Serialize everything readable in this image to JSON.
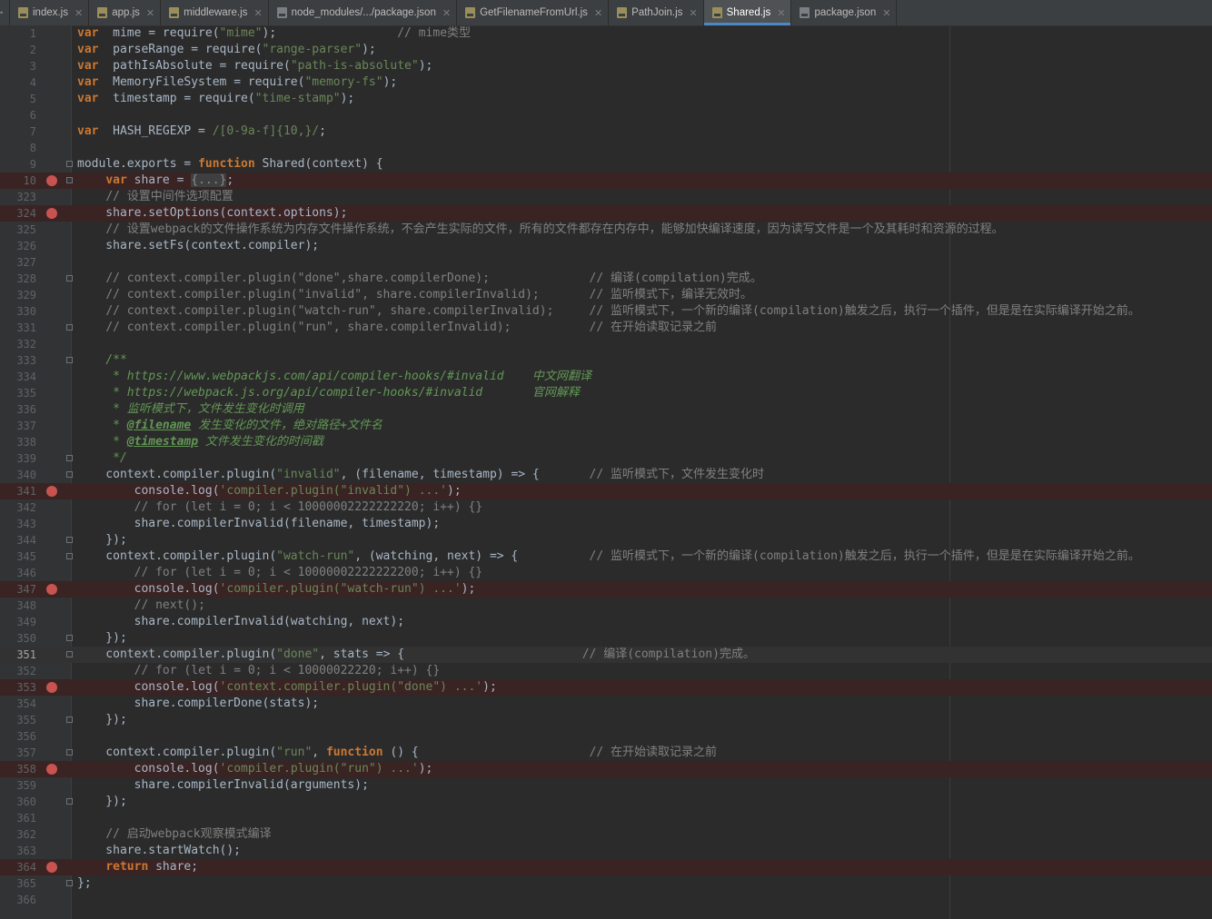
{
  "tabs": [
    {
      "label": "index.js",
      "icon": "js-file-icon",
      "active": false
    },
    {
      "label": "app.js",
      "icon": "js-file-icon",
      "active": false
    },
    {
      "label": "middleware.js",
      "icon": "js-file-icon",
      "active": false
    },
    {
      "label": "node_modules/.../package.json",
      "icon": "json-file-icon",
      "active": false
    },
    {
      "label": "GetFilenameFromUrl.js",
      "icon": "js-file-icon",
      "active": false
    },
    {
      "label": "PathJoin.js",
      "icon": "js-file-icon",
      "active": false
    },
    {
      "label": "Shared.js",
      "icon": "js-file-icon",
      "active": true
    },
    {
      "label": "package.json",
      "icon": "json-file-icon",
      "active": false
    }
  ],
  "editor": {
    "colors": {
      "background": "#2b2b2b",
      "keyword": "#cc7832",
      "string": "#6a8759",
      "comment": "#808080",
      "doc_comment": "#629755",
      "breakpoint": "#c75450",
      "breakpoint_line": "#3a2323",
      "active_tab_underline": "#4a88c7"
    },
    "lines": [
      {
        "num": "1",
        "segs": [
          [
            "kw",
            "var"
          ],
          [
            "",
            "  mime = require("
          ],
          [
            "str",
            "\"mime\""
          ],
          [
            "",
            ");                 "
          ],
          [
            "cm",
            "// mime类型"
          ]
        ]
      },
      {
        "num": "2",
        "segs": [
          [
            "kw",
            "var"
          ],
          [
            "",
            "  parseRange = require("
          ],
          [
            "str",
            "\"range-parser\""
          ],
          [
            "",
            ");"
          ]
        ]
      },
      {
        "num": "3",
        "segs": [
          [
            "kw",
            "var"
          ],
          [
            "",
            "  pathIsAbsolute = require("
          ],
          [
            "str",
            "\"path-is-absolute\""
          ],
          [
            "",
            ");"
          ]
        ]
      },
      {
        "num": "4",
        "segs": [
          [
            "kw",
            "var"
          ],
          [
            "",
            "  MemoryFileSystem = require("
          ],
          [
            "str",
            "\"memory-fs\""
          ],
          [
            "",
            ");"
          ]
        ]
      },
      {
        "num": "5",
        "segs": [
          [
            "kw",
            "var"
          ],
          [
            "",
            "  timestamp = require("
          ],
          [
            "str",
            "\"time-stamp\""
          ],
          [
            "",
            ");"
          ]
        ]
      },
      {
        "num": "6",
        "segs": []
      },
      {
        "num": "7",
        "segs": [
          [
            "kw",
            "var"
          ],
          [
            "",
            "  HASH_REGEXP = "
          ],
          [
            "str",
            "/[0-9a-f]{10,}/"
          ],
          [
            "",
            ";"
          ]
        ]
      },
      {
        "num": "8",
        "segs": []
      },
      {
        "num": "9",
        "fold": true,
        "segs": [
          [
            "",
            "module.exports = "
          ],
          [
            "kw",
            "function"
          ],
          [
            "",
            " Shared(context) {"
          ]
        ]
      },
      {
        "num": "10",
        "bp": true,
        "fold": true,
        "segs": [
          [
            "",
            "    "
          ],
          [
            "kw",
            "var"
          ],
          [
            "",
            " share = "
          ],
          [
            "fold-ph",
            "{...}"
          ],
          [
            "",
            ";"
          ]
        ]
      },
      {
        "num": "323",
        "segs": [
          [
            "",
            "    "
          ],
          [
            "cm",
            "// 设置中间件选项配置"
          ]
        ]
      },
      {
        "num": "324",
        "bp": true,
        "segs": [
          [
            "",
            "    share.setOptions(context.options);"
          ]
        ]
      },
      {
        "num": "325",
        "segs": [
          [
            "",
            "    "
          ],
          [
            "cm",
            "// 设置webpack的文件操作系统为内存文件操作系统，不会产生实际的文件，所有的文件都存在内存中，能够加快编译速度，因为读写文件是一个及其耗时和资源的过程。"
          ]
        ]
      },
      {
        "num": "326",
        "segs": [
          [
            "",
            "    share.setFs(context.compiler);"
          ]
        ]
      },
      {
        "num": "327",
        "segs": []
      },
      {
        "num": "328",
        "fold": true,
        "segs": [
          [
            "",
            "    "
          ],
          [
            "cm",
            "// context.compiler.plugin(\"done\",share.compilerDone);              // 编译(compilation)完成。"
          ]
        ]
      },
      {
        "num": "329",
        "segs": [
          [
            "",
            "    "
          ],
          [
            "cm",
            "// context.compiler.plugin(\"invalid\", share.compilerInvalid);       // 监听模式下，编译无效时。"
          ]
        ]
      },
      {
        "num": "330",
        "segs": [
          [
            "",
            "    "
          ],
          [
            "cm",
            "// context.compiler.plugin(\"watch-run\", share.compilerInvalid);     // 监听模式下，一个新的编译(compilation)触发之后，执行一个插件，但是是在实际编译开始之前。"
          ]
        ]
      },
      {
        "num": "331",
        "fold": true,
        "segs": [
          [
            "",
            "    "
          ],
          [
            "cm",
            "// context.compiler.plugin(\"run\", share.compilerInvalid);           // 在开始读取记录之前"
          ]
        ]
      },
      {
        "num": "332",
        "segs": []
      },
      {
        "num": "333",
        "fold": true,
        "segs": [
          [
            "",
            "    "
          ],
          [
            "doc",
            "/**"
          ]
        ]
      },
      {
        "num": "334",
        "segs": [
          [
            "",
            "     "
          ],
          [
            "doc",
            "* https://www.webpackjs.com/api/compiler-hooks/#invalid    中文网翻译"
          ]
        ]
      },
      {
        "num": "335",
        "segs": [
          [
            "",
            "     "
          ],
          [
            "doc",
            "* https://webpack.js.org/api/compiler-hooks/#invalid       官网解释"
          ]
        ]
      },
      {
        "num": "336",
        "segs": [
          [
            "",
            "     "
          ],
          [
            "doc",
            "* 监听模式下，文件发生变化时调用"
          ]
        ]
      },
      {
        "num": "337",
        "segs": [
          [
            "",
            "     "
          ],
          [
            "doc",
            "* "
          ],
          [
            "doct",
            "@filename"
          ],
          [
            "doc",
            " 发生变化的文件，绝对路径+文件名"
          ]
        ]
      },
      {
        "num": "338",
        "segs": [
          [
            "",
            "     "
          ],
          [
            "doc",
            "* "
          ],
          [
            "doct",
            "@timestamp"
          ],
          [
            "doc",
            " 文件发生变化的时间戳"
          ]
        ]
      },
      {
        "num": "339",
        "fold": true,
        "segs": [
          [
            "",
            "     "
          ],
          [
            "doc",
            "*/"
          ]
        ]
      },
      {
        "num": "340",
        "fold": true,
        "segs": [
          [
            "",
            "    context.compiler.plugin("
          ],
          [
            "str",
            "\"invalid\""
          ],
          [
            "",
            ", (filename, timestamp) => {       "
          ],
          [
            "cm",
            "// 监听模式下，文件发生变化时"
          ]
        ]
      },
      {
        "num": "341",
        "bp": true,
        "segs": [
          [
            "",
            "        console.log("
          ],
          [
            "str",
            "'compiler.plugin(\"invalid\") ...'"
          ],
          [
            "",
            ");"
          ]
        ]
      },
      {
        "num": "342",
        "segs": [
          [
            "",
            "        "
          ],
          [
            "cm",
            "// for (let i = 0; i < 10000002222222220; i++) {}"
          ]
        ]
      },
      {
        "num": "343",
        "segs": [
          [
            "",
            "        share.compilerInvalid(filename, timestamp);"
          ]
        ]
      },
      {
        "num": "344",
        "fold": true,
        "segs": [
          [
            "",
            "    });"
          ]
        ]
      },
      {
        "num": "345",
        "fold": true,
        "segs": [
          [
            "",
            "    context.compiler.plugin("
          ],
          [
            "str",
            "\"watch-run\""
          ],
          [
            "",
            ", (watching, next) => {          "
          ],
          [
            "cm",
            "// 监听模式下，一个新的编译(compilation)触发之后，执行一个插件，但是是在实际编译开始之前。"
          ]
        ]
      },
      {
        "num": "346",
        "segs": [
          [
            "",
            "        "
          ],
          [
            "cm",
            "// for (let i = 0; i < 10000002222222200; i++) {}"
          ]
        ]
      },
      {
        "num": "347",
        "bp": true,
        "segs": [
          [
            "",
            "        console.log("
          ],
          [
            "str",
            "'compiler.plugin(\"watch-run\") ...'"
          ],
          [
            "",
            ");"
          ]
        ]
      },
      {
        "num": "348",
        "segs": [
          [
            "",
            "        "
          ],
          [
            "cm",
            "// next();"
          ]
        ]
      },
      {
        "num": "349",
        "segs": [
          [
            "",
            "        share.compilerInvalid(watching, next);"
          ]
        ]
      },
      {
        "num": "350",
        "fold": true,
        "segs": [
          [
            "",
            "    });"
          ]
        ]
      },
      {
        "num": "351",
        "cur": true,
        "fold": true,
        "segs": [
          [
            "",
            "    context.compiler.plugin("
          ],
          [
            "str",
            "\"done\""
          ],
          [
            "",
            ", stats => {                         "
          ],
          [
            "cm",
            "// 编译(compilation)完成。"
          ]
        ]
      },
      {
        "num": "352",
        "segs": [
          [
            "",
            "        "
          ],
          [
            "cm",
            "// for (let i = 0; i < 10000022220; i++) {}"
          ]
        ]
      },
      {
        "num": "353",
        "bp": true,
        "segs": [
          [
            "",
            "        console.log("
          ],
          [
            "str",
            "'context.compiler.plugin(\"done\") ...'"
          ],
          [
            "",
            ");"
          ]
        ]
      },
      {
        "num": "354",
        "segs": [
          [
            "",
            "        share.compilerDone(stats);"
          ]
        ]
      },
      {
        "num": "355",
        "fold": true,
        "segs": [
          [
            "",
            "    });"
          ]
        ]
      },
      {
        "num": "356",
        "segs": []
      },
      {
        "num": "357",
        "fold": true,
        "segs": [
          [
            "",
            "    context.compiler.plugin("
          ],
          [
            "str",
            "\"run\""
          ],
          [
            "",
            ", "
          ],
          [
            "kw",
            "function"
          ],
          [
            "",
            " () {                        "
          ],
          [
            "cm",
            "// 在开始读取记录之前"
          ]
        ]
      },
      {
        "num": "358",
        "bp": true,
        "segs": [
          [
            "",
            "        console.log("
          ],
          [
            "str",
            "'compiler.plugin(\"run\") ...'"
          ],
          [
            "",
            ");"
          ]
        ]
      },
      {
        "num": "359",
        "segs": [
          [
            "",
            "        share.compilerInvalid(arguments);"
          ]
        ]
      },
      {
        "num": "360",
        "fold": true,
        "segs": [
          [
            "",
            "    });"
          ]
        ]
      },
      {
        "num": "361",
        "segs": []
      },
      {
        "num": "362",
        "segs": [
          [
            "",
            "    "
          ],
          [
            "cm",
            "// 启动webpack观察模式编译"
          ]
        ]
      },
      {
        "num": "363",
        "segs": [
          [
            "",
            "    share.startWatch();"
          ]
        ]
      },
      {
        "num": "364",
        "bp": true,
        "segs": [
          [
            "",
            "    "
          ],
          [
            "kw",
            "return"
          ],
          [
            "",
            " share;"
          ]
        ]
      },
      {
        "num": "365",
        "fold": true,
        "segs": [
          [
            "",
            "};"
          ]
        ]
      },
      {
        "num": "366",
        "segs": []
      }
    ]
  }
}
